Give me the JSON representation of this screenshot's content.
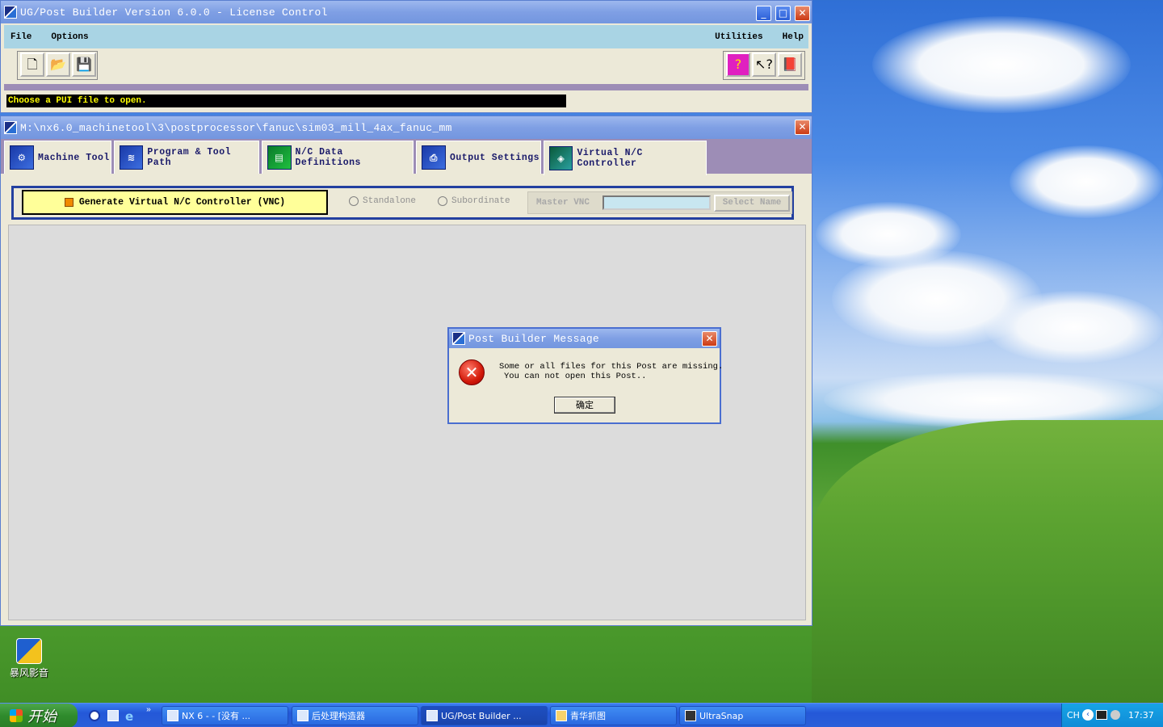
{
  "main_window": {
    "title": "UG/Post Builder Version 6.0.0 - License Control",
    "menu": {
      "file": "File",
      "options": "Options",
      "utilities": "Utilities",
      "help": "Help"
    },
    "status_text": "Choose a PUI file to open."
  },
  "post_window": {
    "title": "M:\\nx6.0_machinetool\\3\\postprocessor\\fanuc\\sim03_mill_4ax_fanuc_mm",
    "tabs": [
      "Machine Tool",
      "Program & Tool Path",
      "N/C Data Definitions",
      "Output Settings",
      "Virtual N/C Controller"
    ],
    "active_tab": "Virtual N/C Controller",
    "vnc": {
      "generate_label": "Generate Virtual N/C Controller (VNC)",
      "standalone_label": "Standalone",
      "subordinate_label": "Subordinate",
      "master_vnc_label": "Master VNC",
      "master_vnc_value": "",
      "select_name_label": "Select Name"
    }
  },
  "dialog": {
    "title": "Post Builder Message",
    "line1": "Some or all files for this Post are missing.",
    "line2": "You can not open this Post..",
    "ok_label": "确定"
  },
  "desktop": {
    "icon_label": "暴风影音"
  },
  "taskbar": {
    "start_label": "开始",
    "tasks": [
      "NX 6 - - [没有 ...",
      "后处理构造器",
      "UG/Post Builder ...",
      "青华抓图",
      "UltraSnap"
    ],
    "lang": "CH",
    "clock": "17:37"
  },
  "colors": {
    "vnc_panel": "#2340a0",
    "generate_bg": "#ffff99",
    "status_bg": "#000000",
    "status_text": "#ffff00"
  }
}
